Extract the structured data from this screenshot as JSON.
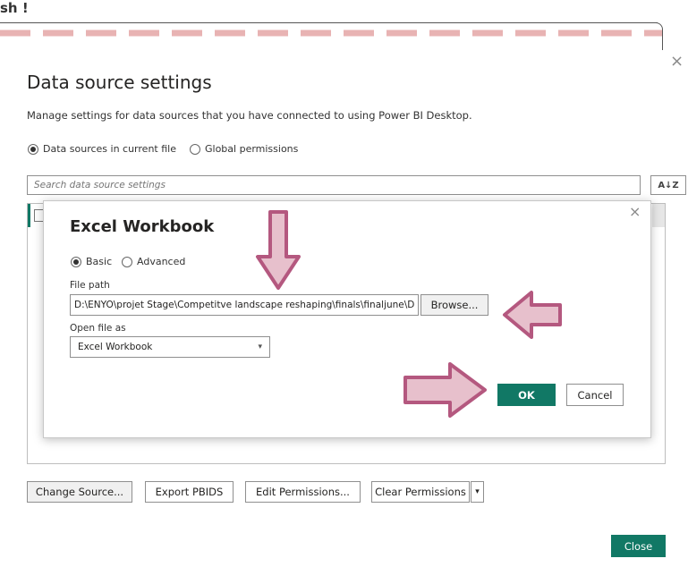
{
  "overlay": {
    "top_text": "sh !"
  },
  "dialog": {
    "title": "Data source settings",
    "close_symbol": "×",
    "description": "Manage settings for data sources that you have connected to using Power BI Desktop.",
    "scope_options": [
      {
        "label": "Data sources in current file",
        "selected": true
      },
      {
        "label": "Global permissions",
        "selected": false
      }
    ],
    "search": {
      "placeholder": "Search data source settings",
      "value": ""
    },
    "sort_icon": "sort-az-icon",
    "sort_label": "A↓Z",
    "buttons": {
      "change_source": "Change Source...",
      "export_pbids": "Export PBIDS",
      "edit_permissions": "Edit Permissions...",
      "clear_permissions": "Clear Permissions",
      "close": "Close"
    },
    "dropdown_symbol": "▾"
  },
  "excel_dialog": {
    "title": "Excel Workbook",
    "close_symbol": "×",
    "mode_options": [
      {
        "label": "Basic",
        "selected": true
      },
      {
        "label": "Advanced",
        "selected": false
      }
    ],
    "file_path_label": "File path",
    "file_path_value": "D:\\ENYO\\projet Stage\\Competitve landscape reshaping\\finals\\finaljune\\Dr",
    "browse_label": "Browse...",
    "open_file_as_label": "Open file as",
    "open_file_as_value": "Excel Workbook",
    "select_arrow": "▾",
    "ok_label": "OK",
    "cancel_label": "Cancel"
  },
  "colors": {
    "accent": "#117865",
    "arrow_fill": "#e7c0cc",
    "arrow_stroke": "#b4587f",
    "dash": "#e8b3b3"
  }
}
